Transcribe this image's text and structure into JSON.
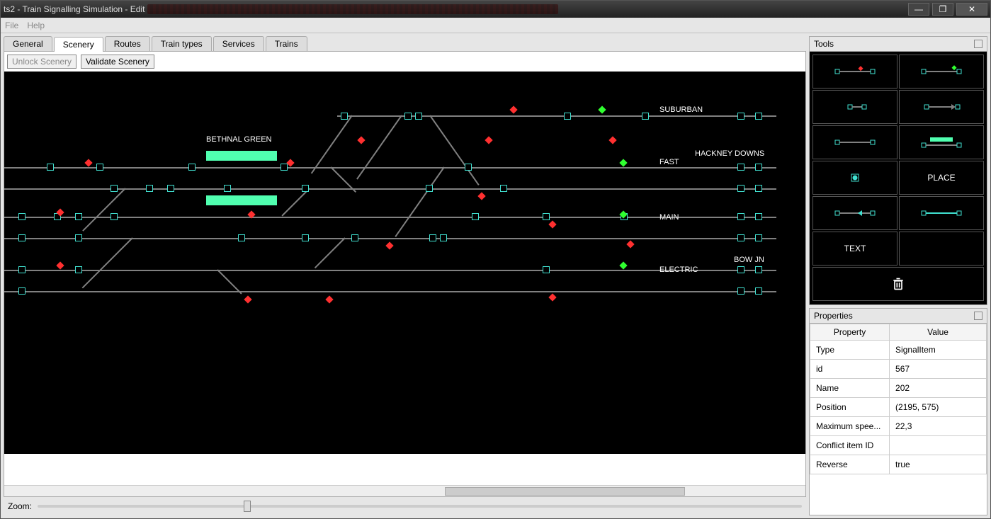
{
  "window": {
    "title": "ts2 - Train Signalling Simulation - Edit"
  },
  "menu": {
    "file": "File",
    "help": "Help"
  },
  "tabs": [
    "General",
    "Scenery",
    "Routes",
    "Train types",
    "Services",
    "Trains"
  ],
  "active_tab": 1,
  "toolbar": {
    "unlock": "Unlock Scenery",
    "validate": "Validate Scenery"
  },
  "canvas": {
    "labels": {
      "bethnal_green": "BETHNAL GREEN",
      "suburban": "SUBURBAN",
      "hackney_downs": "HACKNEY DOWNS",
      "fast": "FAST",
      "main": "MAIN",
      "bow_jn": "BOW JN",
      "electric": "ELECTRIC"
    }
  },
  "zoom": {
    "label": "Zoom:"
  },
  "tools": {
    "title": "Tools",
    "place": "PLACE",
    "text": "TEXT"
  },
  "properties": {
    "title": "Properties",
    "headers": {
      "prop": "Property",
      "val": "Value"
    },
    "rows": [
      {
        "p": "Type",
        "v": "SignalItem"
      },
      {
        "p": "id",
        "v": "567"
      },
      {
        "p": "Name",
        "v": "202"
      },
      {
        "p": "Position",
        "v": "(2195, 575)"
      },
      {
        "p": "Maximum spee...",
        "v": "22,3"
      },
      {
        "p": "Conflict item ID",
        "v": ""
      },
      {
        "p": "Reverse",
        "v": "true"
      }
    ]
  }
}
